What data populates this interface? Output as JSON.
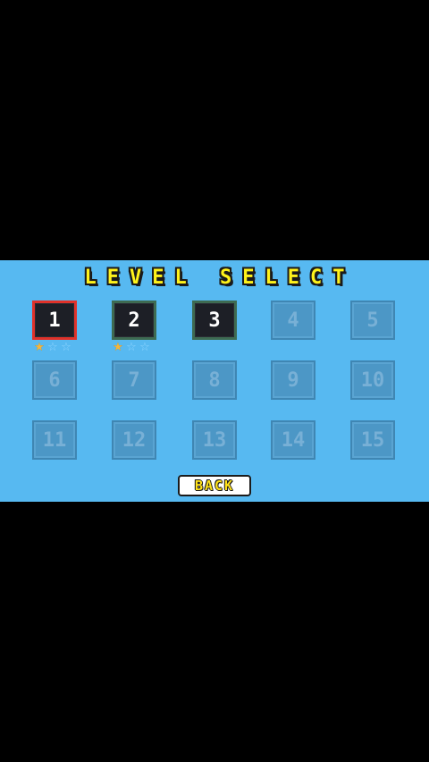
{
  "screen": {
    "title": "LEVEL SELECT",
    "back_label": "BACK"
  },
  "colors": {
    "background": "#57b9f1",
    "letterbox": "#000000",
    "title_fill": "#fff21a",
    "unlocked_tile": "#1d1f26",
    "locked_tile": "#4c97c6",
    "selected_border": "#e0322a",
    "star_filled": "#f4b63c",
    "star_empty": "#8fd4ff"
  },
  "levels": [
    {
      "label": "1",
      "state": "unlocked",
      "selected": true,
      "stars_earned": 1,
      "stars_total": 3
    },
    {
      "label": "2",
      "state": "unlocked",
      "selected": false,
      "stars_earned": 1,
      "stars_total": 3
    },
    {
      "label": "3",
      "state": "unlocked",
      "selected": false
    },
    {
      "label": "4",
      "state": "locked"
    },
    {
      "label": "5",
      "state": "locked"
    },
    {
      "label": "6",
      "state": "locked"
    },
    {
      "label": "7",
      "state": "locked"
    },
    {
      "label": "8",
      "state": "locked"
    },
    {
      "label": "9",
      "state": "locked"
    },
    {
      "label": "10",
      "state": "locked"
    },
    {
      "label": "11",
      "state": "locked"
    },
    {
      "label": "12",
      "state": "locked"
    },
    {
      "label": "13",
      "state": "locked"
    },
    {
      "label": "14",
      "state": "locked"
    },
    {
      "label": "15",
      "state": "locked"
    }
  ]
}
